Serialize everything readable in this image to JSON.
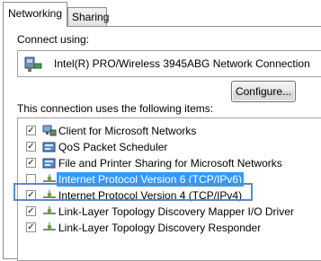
{
  "tabs": [
    {
      "label": "Networking"
    },
    {
      "label": "Sharing"
    }
  ],
  "connect_using": {
    "label": "Connect using:",
    "adapter_name": "Intel(R) PRO/Wireless 3945ABG Network Connection",
    "configure_label": "Configure..."
  },
  "items_section": {
    "label": "This connection uses the following items:",
    "items": [
      {
        "label": "Client for Microsoft Networks",
        "checked": true,
        "icon": "network-client-icon"
      },
      {
        "label": "QoS Packet Scheduler",
        "checked": true,
        "icon": "service-icon"
      },
      {
        "label": "File and Printer Sharing for Microsoft Networks",
        "checked": true,
        "icon": "service-icon"
      },
      {
        "label": "Internet Protocol Version 6 (TCP/IPv6)",
        "checked": false,
        "selected": true,
        "icon": "protocol-icon"
      },
      {
        "label": "Internet Protocol Version 4 (TCP/IPv4)",
        "checked": true,
        "icon": "protocol-icon"
      },
      {
        "label": "Link-Layer Topology Discovery Mapper I/O Driver",
        "checked": true,
        "icon": "protocol-icon"
      },
      {
        "label": "Link-Layer Topology Discovery Responder",
        "checked": true,
        "icon": "protocol-icon"
      }
    ]
  },
  "colors": {
    "selection": "#3399ff",
    "highlight_frame": "#5b8bc0"
  }
}
